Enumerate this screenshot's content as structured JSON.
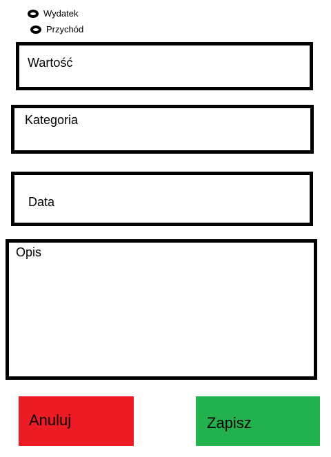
{
  "type_selector": {
    "options": [
      {
        "label": "Wydatek"
      },
      {
        "label": "Przychód"
      }
    ]
  },
  "form": {
    "value_label": "Wartość",
    "category_label": "Kategoria",
    "date_label": "Data",
    "description_label": "Opis"
  },
  "actions": {
    "cancel_label": "Anuluj",
    "save_label": "Zapisz"
  },
  "colors": {
    "cancel": "#ed1c24",
    "save": "#22b14c"
  }
}
